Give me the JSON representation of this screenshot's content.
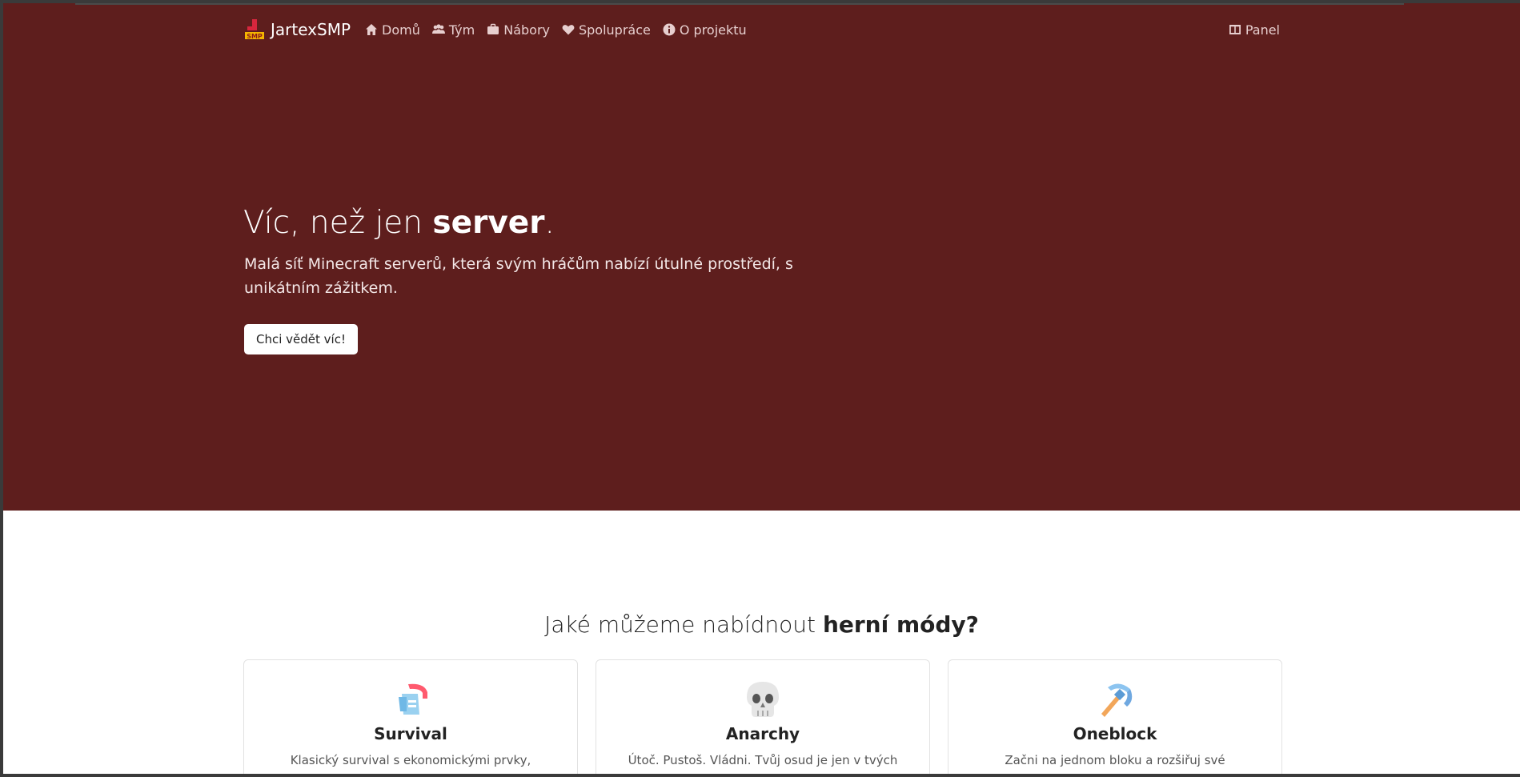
{
  "nav": {
    "brand": "JartexSMP",
    "items": [
      {
        "label": "Domů",
        "icon": "home-icon"
      },
      {
        "label": "Tým",
        "icon": "users-icon"
      },
      {
        "label": "Nábory",
        "icon": "briefcase-icon"
      },
      {
        "label": "Spolupráce",
        "icon": "heart-icon"
      },
      {
        "label": "O projektu",
        "icon": "info-icon"
      }
    ],
    "panel": {
      "label": "Panel",
      "icon": "columns-icon"
    }
  },
  "hero": {
    "title_pre": "Víc, než jen ",
    "title_bold": "server",
    "title_post": ".",
    "subtitle": "Malá síť Minecraft serverů, která svým hráčům nabízí útulné prostředí, s unikátním zážitkem.",
    "cta_label": "Chci vědět víc!"
  },
  "modes": {
    "title_pre": "Jaké můžeme nabídnout ",
    "title_bold": "herní módy?",
    "cards": [
      {
        "title": "Survival",
        "desc": "Klasický survival s ekonomickými prvky,",
        "icon": "helmet-icon"
      },
      {
        "title": "Anarchy",
        "desc": "Útoč. Pustoš. Vládni. Tvůj osud je jen v tvých",
        "icon": "skull-icon"
      },
      {
        "title": "Oneblock",
        "desc": "Začni na jednom bloku a rozšiřuj své",
        "icon": "pickaxe-icon"
      }
    ]
  },
  "colors": {
    "hero_bg": "#5e1e1d",
    "nav_text": "#e7cfcf"
  }
}
